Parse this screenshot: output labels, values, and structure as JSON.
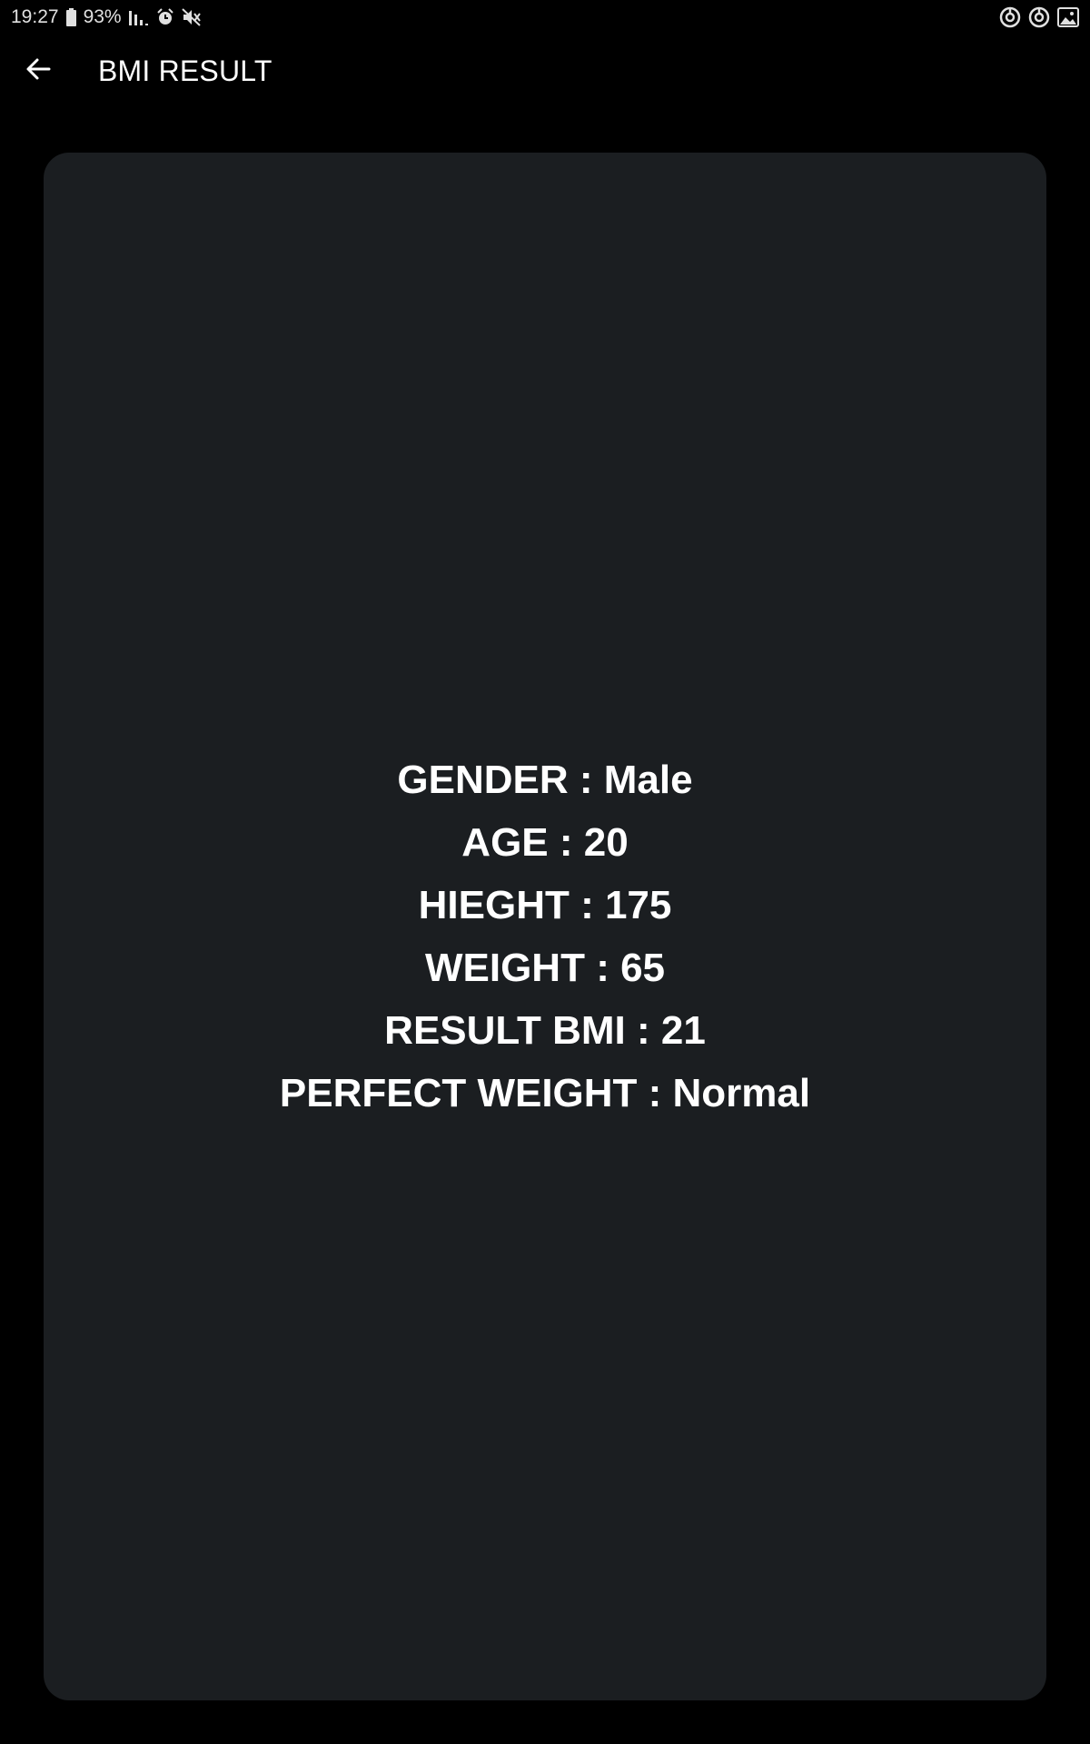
{
  "status_bar": {
    "time": "19:27",
    "battery": "93%",
    "icons": [
      "battery-icon",
      "signal-icon",
      "alarm-icon",
      "mute-icon",
      "sync-icon",
      "sync-icon",
      "image-icon"
    ]
  },
  "app_bar": {
    "back_icon": "arrow-left-icon",
    "title": "BMI RESULT"
  },
  "result": {
    "gender": "GENDER : Male",
    "age": "AGE : 20",
    "height": "HIEGHT : 175",
    "weight": "WEIGHT : 65",
    "bmi": "RESULT BMI : 21",
    "category": "PERFECT WEIGHT : Normal"
  },
  "colors": {
    "background": "#000000",
    "card": "#1b1e21",
    "text": "#ffffff"
  }
}
